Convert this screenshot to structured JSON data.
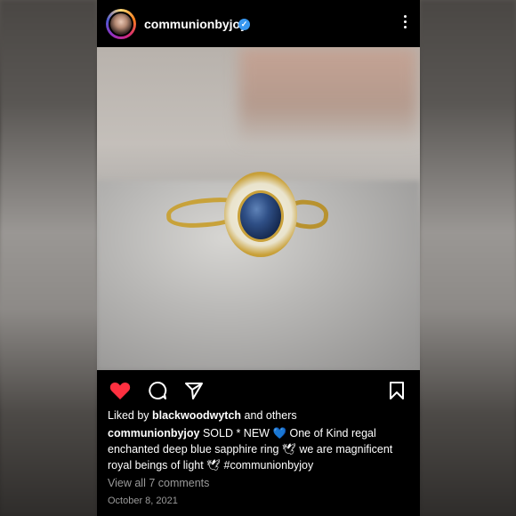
{
  "post": {
    "username": "communionbyjoy",
    "verified_mark": "✓",
    "liked_by_prefix": "Liked by ",
    "liked_by_user": "blackwoodwytch",
    "liked_by_suffix": " and others",
    "caption_user": "communionbyjoy",
    "caption_text": " SOLD * NEW 💙  One of Kind regal enchanted deep blue sapphire ring 🕊 we are magnificent royal beings of light 🕊 #communionbyjoy",
    "view_comments": "View all 7 comments",
    "date": "October 8, 2021"
  },
  "icons": {
    "like": "heart-icon",
    "comment": "comment-icon",
    "share": "send-icon",
    "save": "bookmark-icon",
    "more": "more-vertical-icon",
    "verified": "verified-badge-icon"
  },
  "colors": {
    "like": "#ff3040",
    "verified": "#3897f0",
    "muted": "#9a9a9a"
  }
}
